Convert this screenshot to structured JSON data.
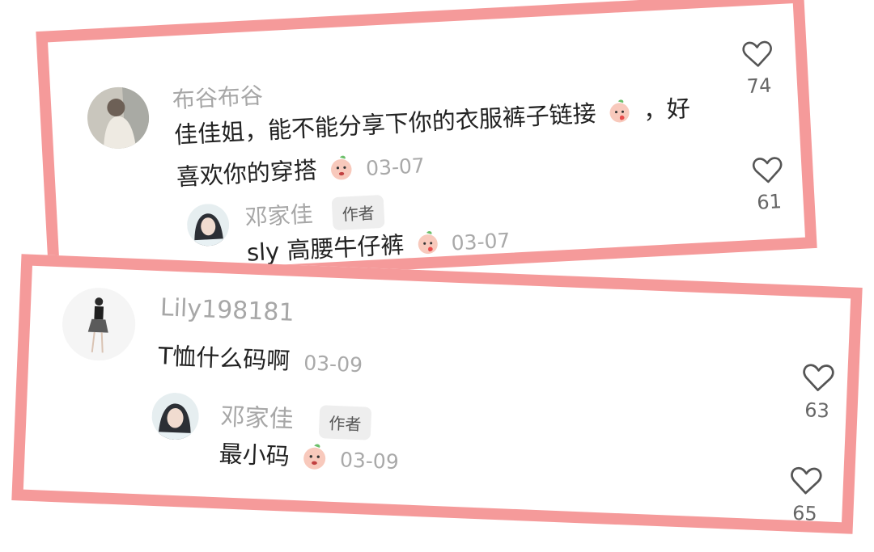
{
  "thread1": {
    "comment": {
      "username": "布谷布谷",
      "text_line1": "佳佳姐，能不能分享下你的衣服裤子链接",
      "text_line1_end": "，好",
      "text_line2": "喜欢你的穿搭",
      "date": "03-07",
      "likes": "74"
    },
    "reply": {
      "username": "邓家佳",
      "badge": "作者",
      "text": "sly 高腰牛仔裤",
      "date": "03-07",
      "likes": "61"
    }
  },
  "thread2": {
    "comment": {
      "username": "Lily198181",
      "text": "T恤什么码啊",
      "date": "03-09",
      "likes": "63"
    },
    "reply": {
      "username": "邓家佳",
      "badge": "作者",
      "text": "最小码",
      "date": "03-09",
      "likes": "65"
    }
  },
  "colors": {
    "frame": "#f59a9a",
    "username": "#a7a7a7",
    "text": "#222222",
    "date": "#a9a9a9"
  },
  "icons": {
    "like": "heart-outline-icon",
    "emoji": "peach-emoji"
  }
}
